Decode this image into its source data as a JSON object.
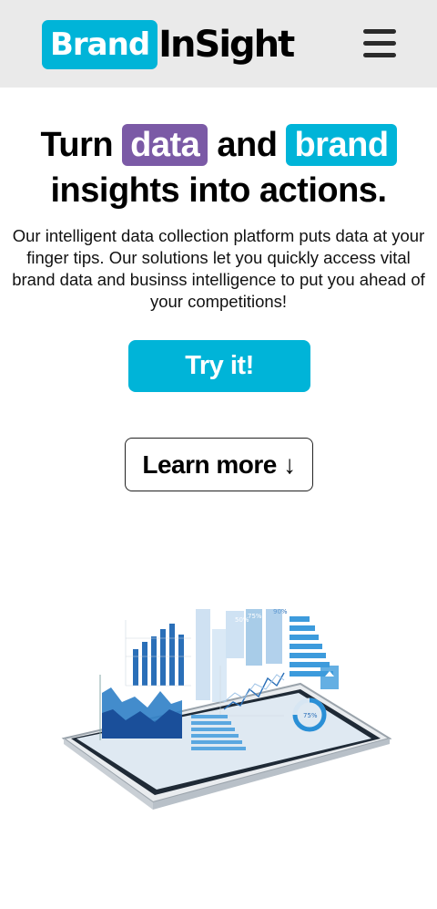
{
  "header": {
    "logo_brand": "Brand",
    "logo_rest": "InSight",
    "menu_icon": "hamburger-menu-icon"
  },
  "hero": {
    "headline_turn": "Turn",
    "headline_data": "data",
    "headline_and": "and",
    "headline_brand": "brand",
    "headline_line2": "insights into actions.",
    "description": "Our intelligent data collection platform puts data at your finger tips. Our solutions let you quickly access vital brand data and businss intelligence to put you ahead of your competitions!",
    "try_label": "Try it!",
    "learn_label": "Learn more ↓"
  },
  "image": {
    "icon": "tablet-analytics-illustration",
    "chart_labels": [
      "50%",
      "75%",
      "90%",
      "75%"
    ]
  },
  "colors": {
    "accent": "#00b4d8",
    "purple": "#7b5aa6",
    "header_bg": "#eaeaea"
  }
}
